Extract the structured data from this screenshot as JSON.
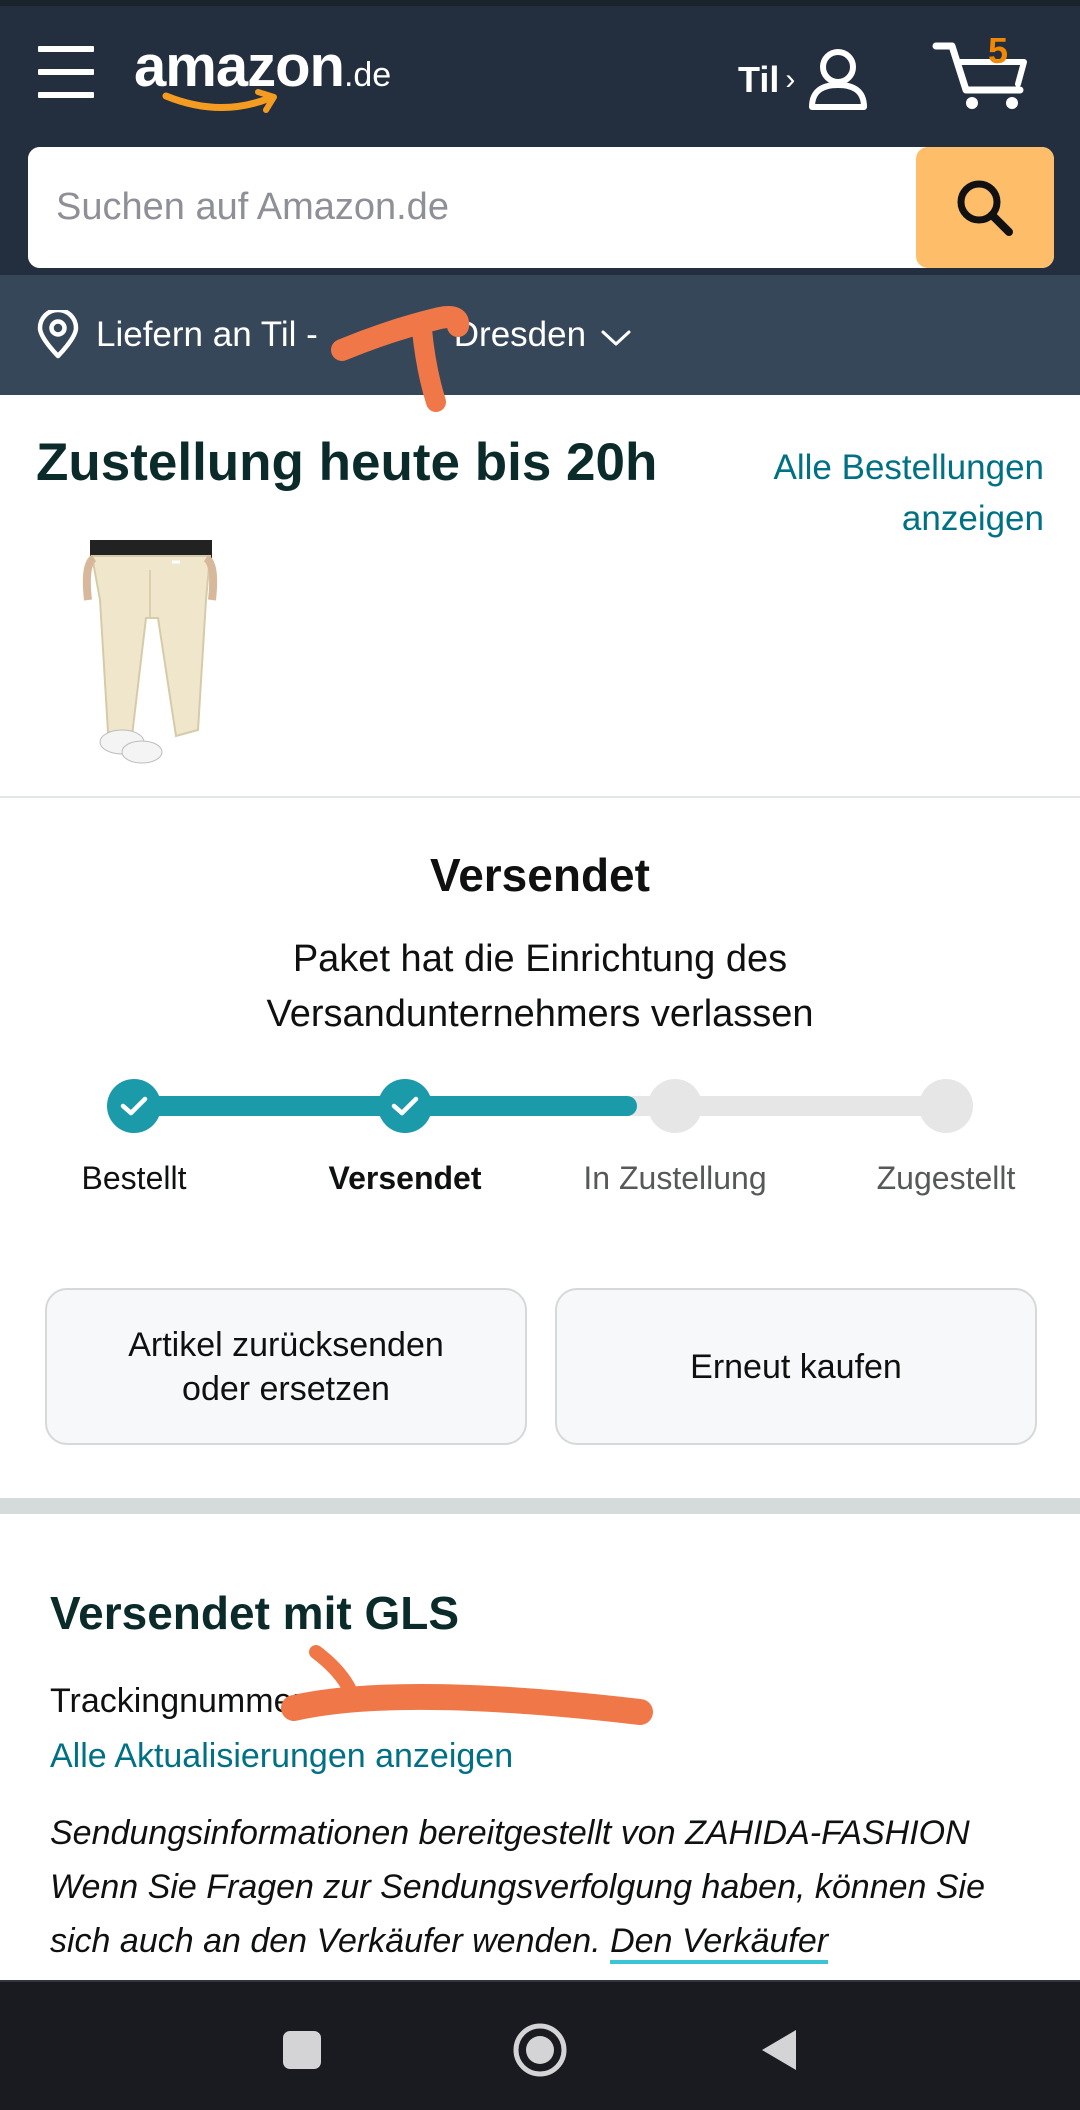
{
  "header": {
    "logo_text": "amazon",
    "logo_tld": ".de",
    "account_label": "Til",
    "account_chevron": "›",
    "cart_count": "5",
    "search_placeholder": "Suchen auf Amazon.de",
    "icons": [
      "menu-icon",
      "user-icon",
      "cart-icon",
      "search-icon"
    ],
    "colors": {
      "header_bg": "#232f3e",
      "sub_bar_bg": "#37475a",
      "search_button": "#febd69",
      "cart_count": "#f08804"
    }
  },
  "delivery_bar": {
    "prefix": "Liefern an Til -",
    "city": "Dresden",
    "icons": [
      "location-pin-icon",
      "chevron-down-icon"
    ]
  },
  "delivery": {
    "title": "Zustellung heute bis 20h",
    "orders_link_line1": "Alle Bestellungen",
    "orders_link_line2": "anzeigen"
  },
  "status": {
    "title": "Versendet",
    "subtitle": "Paket hat die Einrichtung des Versandunternehmers verlassen",
    "progress_fraction": 0.62,
    "accent_color": "#1b9aaa",
    "steps": [
      {
        "label": "Bestellt",
        "state": "done"
      },
      {
        "label": "Versendet",
        "state": "done"
      },
      {
        "label": "In Zustellung",
        "state": "pending"
      },
      {
        "label": "Zugestellt",
        "state": "pending"
      }
    ]
  },
  "actions": {
    "return_line1": "Artikel zurücksenden",
    "return_line2": "oder ersetzen",
    "rebuy_label": "Erneut kaufen"
  },
  "carrier": {
    "title": "Versendet mit GLS",
    "tracking_label": "Trackingnummer",
    "updates_link": "Alle Aktualisierungen anzeigen",
    "info_text": "Sendungsinformationen bereitgestellt von ZAHIDA-FASHION Wenn Sie Fragen zur Sendungsverfolgung haben, können Sie sich auch an den Verkäufer wenden.",
    "seller_link": "Den Verkäufer"
  },
  "system_nav": {
    "icons": [
      "recents-icon",
      "home-icon",
      "back-icon"
    ]
  }
}
